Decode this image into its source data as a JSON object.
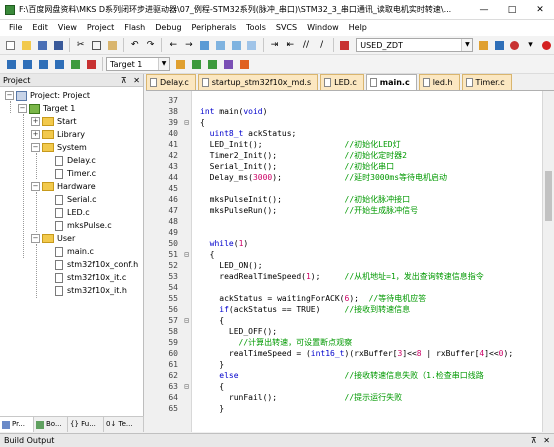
{
  "window": {
    "title": "F:\\百度网盘资料\\MKS D系列闭环步进驱动器\\07_例程-STM32系列(脉冲_串口)\\STM32_3_串口通讯_读取电机实时转速\\...",
    "minimize": "—",
    "maximize": "□",
    "close": "✕"
  },
  "menu": [
    "File",
    "Edit",
    "View",
    "Project",
    "Flash",
    "Debug",
    "Peripherals",
    "Tools",
    "SVCS",
    "Window",
    "Help"
  ],
  "toolbar": {
    "target_combo": "USED_ZDT",
    "build_target": "Target 1"
  },
  "project_panel": {
    "title": "Project",
    "pin": "⊼",
    "close": "✕",
    "root": "Project: Project",
    "target": "Target 1",
    "groups": [
      {
        "name": "Start",
        "expanded": false,
        "files": []
      },
      {
        "name": "Library",
        "expanded": false,
        "files": []
      },
      {
        "name": "System",
        "expanded": true,
        "files": [
          "Delay.c",
          "Timer.c"
        ]
      },
      {
        "name": "Hardware",
        "expanded": true,
        "files": [
          "Serial.c",
          "LED.c",
          "mksPulse.c"
        ]
      },
      {
        "name": "User",
        "expanded": true,
        "files": [
          "main.c",
          "stm32f10x_conf.h",
          "stm32f10x_it.c",
          "stm32f10x_it.h"
        ]
      }
    ],
    "tabs": [
      "Pr...",
      "Bo...",
      "{} Fu...",
      "0↓ Te..."
    ]
  },
  "editor": {
    "tabs": [
      {
        "label": "Delay.c",
        "active": false
      },
      {
        "label": "startup_stm32f10x_md.s",
        "active": false
      },
      {
        "label": "LED.c",
        "active": false
      },
      {
        "label": "main.c",
        "active": true
      },
      {
        "label": "led.h",
        "active": false
      },
      {
        "label": "Timer.c",
        "active": false
      }
    ],
    "lines": [
      {
        "n": "37",
        "fold": "",
        "code": ""
      },
      {
        "n": "38",
        "fold": "",
        "code": "int main(void)"
      },
      {
        "n": "39",
        "fold": "⊟",
        "code": "{"
      },
      {
        "n": "40",
        "fold": "",
        "code": "  uint8_t ackStatus;"
      },
      {
        "n": "41",
        "fold": "",
        "code": "  LED_Init();",
        "comment": "//初始化LED灯"
      },
      {
        "n": "42",
        "fold": "",
        "code": "  Timer2_Init();",
        "comment": "//初始化定时器2"
      },
      {
        "n": "43",
        "fold": "",
        "code": "  Serial_Init();",
        "comment": "//初始化串口"
      },
      {
        "n": "44",
        "fold": "",
        "code": "  Delay_ms(3000);",
        "comment": "//延时3000ms等待电机启动"
      },
      {
        "n": "45",
        "fold": "",
        "code": ""
      },
      {
        "n": "46",
        "fold": "",
        "code": "  mksPulseInit();",
        "comment": "//初始化脉冲接口"
      },
      {
        "n": "47",
        "fold": "",
        "code": "  mksPulseRun();",
        "comment": "//开始生成脉冲信号"
      },
      {
        "n": "48",
        "fold": "",
        "code": ""
      },
      {
        "n": "49",
        "fold": "",
        "code": ""
      },
      {
        "n": "50",
        "fold": "",
        "code": "  while(1)"
      },
      {
        "n": "51",
        "fold": "⊟",
        "code": "  {"
      },
      {
        "n": "52",
        "fold": "",
        "code": "    LED_ON();"
      },
      {
        "n": "53",
        "fold": "",
        "code": "    readRealTimeSpeed(1);",
        "comment": "//从机地址=1，发出查询转速信息指令"
      },
      {
        "n": "54",
        "fold": "",
        "code": ""
      },
      {
        "n": "55",
        "fold": "",
        "code": "    ackStatus = waitingForACK(6);",
        "comment": "//等待电机应答"
      },
      {
        "n": "56",
        "fold": "",
        "code": "    if(ackStatus == TRUE)",
        "comment": "//接收到转速信息"
      },
      {
        "n": "57",
        "fold": "⊟",
        "code": "    {"
      },
      {
        "n": "58",
        "fold": "",
        "code": "      LED_OFF();"
      },
      {
        "n": "59",
        "fold": "",
        "code": "",
        "comment": "      //计算出转速，可设置断点观察"
      },
      {
        "n": "60",
        "fold": "",
        "code": "      realTimeSpeed = (int16_t)(rxBuffer[3]<<8 | rxBuffer[4]<<0);"
      },
      {
        "n": "61",
        "fold": "",
        "code": "    }"
      },
      {
        "n": "62",
        "fold": "",
        "code": "    else",
        "comment": "//接收转速信息失败（1.检查串口线路"
      },
      {
        "n": "63",
        "fold": "⊟",
        "code": "    {"
      },
      {
        "n": "64",
        "fold": "",
        "code": "      runFail();",
        "comment": "//提示运行失败"
      },
      {
        "n": "65",
        "fold": "",
        "code": "    }"
      }
    ]
  },
  "build_output": {
    "title": "Build Output",
    "pin": "⊼",
    "close": "✕"
  },
  "colors": {
    "comment": "#009900",
    "keyword": "#0000cc",
    "number": "#cc0066",
    "tab_inactive": "#fbe7c1"
  }
}
